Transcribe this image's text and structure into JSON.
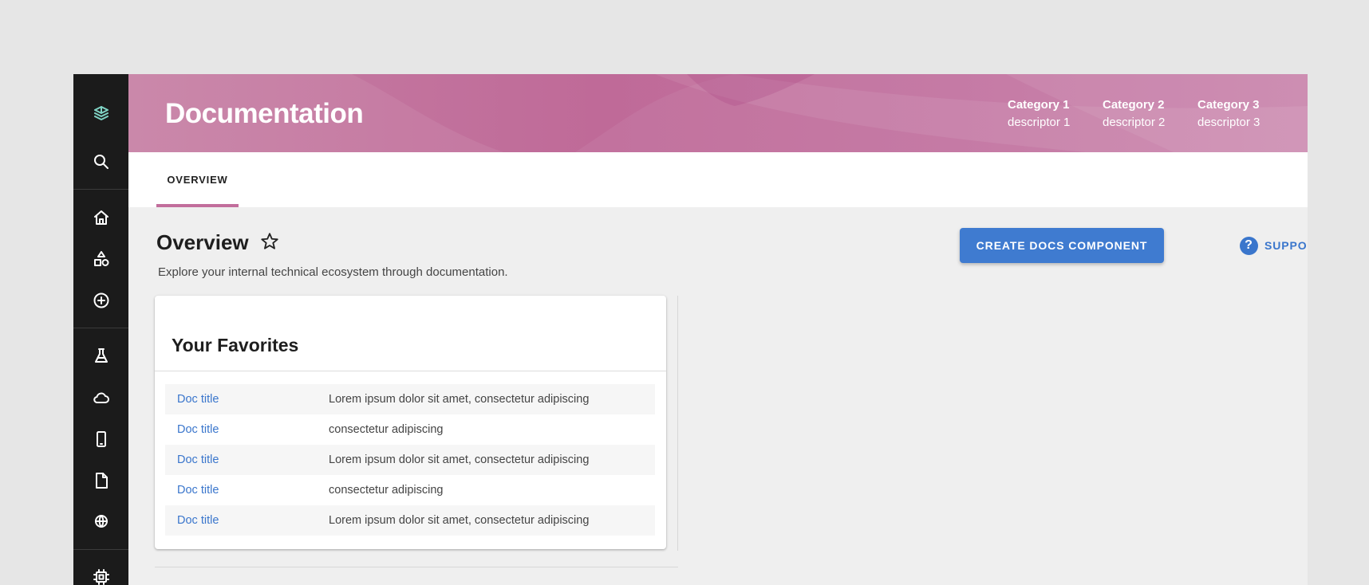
{
  "header": {
    "title": "Documentation",
    "categories": [
      {
        "name": "Category 1",
        "descriptor": "descriptor 1"
      },
      {
        "name": "Category 2",
        "descriptor": "descriptor 2"
      },
      {
        "name": "Category 3",
        "descriptor": "descriptor 3"
      }
    ]
  },
  "tabs": [
    {
      "label": "OVERVIEW",
      "active": true
    }
  ],
  "page": {
    "title": "Overview",
    "subtitle": "Explore your internal technical ecosystem through documentation.",
    "create_button": "CREATE DOCS COMPONENT",
    "support_label": "SUPPORT"
  },
  "favorites": {
    "title": "Your Favorites",
    "rows": [
      {
        "title": "Doc title",
        "description": "Lorem ipsum dolor sit amet, consectetur adipiscing"
      },
      {
        "title": "Doc title",
        "description": "consectetur adipiscing"
      },
      {
        "title": "Doc title",
        "description": "Lorem ipsum dolor sit amet, consectetur adipiscing"
      },
      {
        "title": "Doc title",
        "description": "consectetur adipiscing"
      },
      {
        "title": "Doc title",
        "description": "Lorem ipsum dolor sit amet, consectetur adipiscing"
      }
    ]
  },
  "sidebar": {
    "icons": [
      "logo-icon",
      "search-icon",
      "home-icon",
      "catalog-icon",
      "create-icon",
      "lab-icon",
      "cloud-icon",
      "mobile-icon",
      "document-icon",
      "globe-icon",
      "chip-icon"
    ]
  },
  "colors": {
    "sidebar": "#1b1b1b",
    "header": "#c06c9b",
    "accent": "#c26e9c",
    "primary": "#3f7bd0",
    "link": "#3a76cc",
    "logo": "#7fd3c4"
  }
}
